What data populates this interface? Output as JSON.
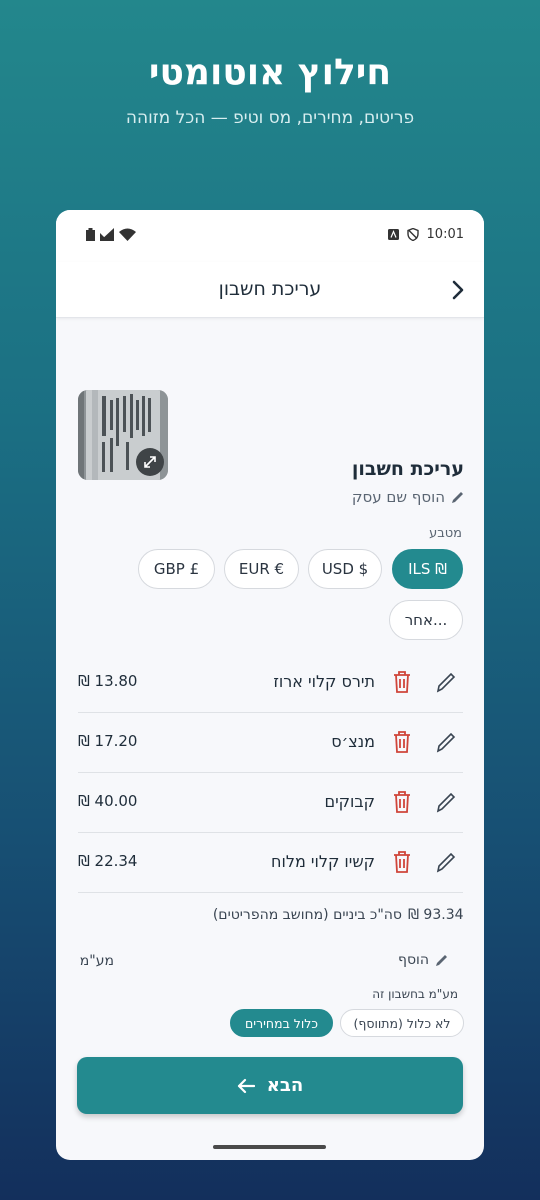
{
  "hero": {
    "title": "חילוץ אוטומטי",
    "subtitle": "פריטים, מחירים, מס וטיפ — הכל מזוהה"
  },
  "status_bar": {
    "time": "10:01"
  },
  "app_bar": {
    "title": "עריכת חשבון"
  },
  "document": {
    "title": "עריכת חשבון",
    "add_business_label": "הוסף שם עסק"
  },
  "currency": {
    "label": "מטבע",
    "options": [
      "ILS ₪",
      "USD $",
      "EUR €",
      "GBP £",
      "אחר..."
    ],
    "selected": "ILS ₪"
  },
  "items": [
    {
      "name": "תירס קלוי ארוז",
      "price": "₪ 13.80"
    },
    {
      "name": "מנצ׳ס",
      "price": "₪ 17.20"
    },
    {
      "name": "קבוקים",
      "price": "₪ 40.00"
    },
    {
      "name": "קשיו קלוי מלוח",
      "price": "₪ 22.34"
    }
  ],
  "totals": {
    "subtotal_label": "סה\"כ ביניים (מחושב מהפריטים)",
    "subtotal_value": "₪ 93.34"
  },
  "vat": {
    "label": "מע\"מ",
    "add_label": "הוסף",
    "sub_label": "מע\"מ בחשבון זה",
    "options": [
      "לא כלול (מתווסף)",
      "כלול במחירים"
    ],
    "selected": "כלול במחירים"
  },
  "next_button": {
    "label": "הבא"
  },
  "colors": {
    "accent": "#238a8f",
    "delete": "#d0453a"
  }
}
